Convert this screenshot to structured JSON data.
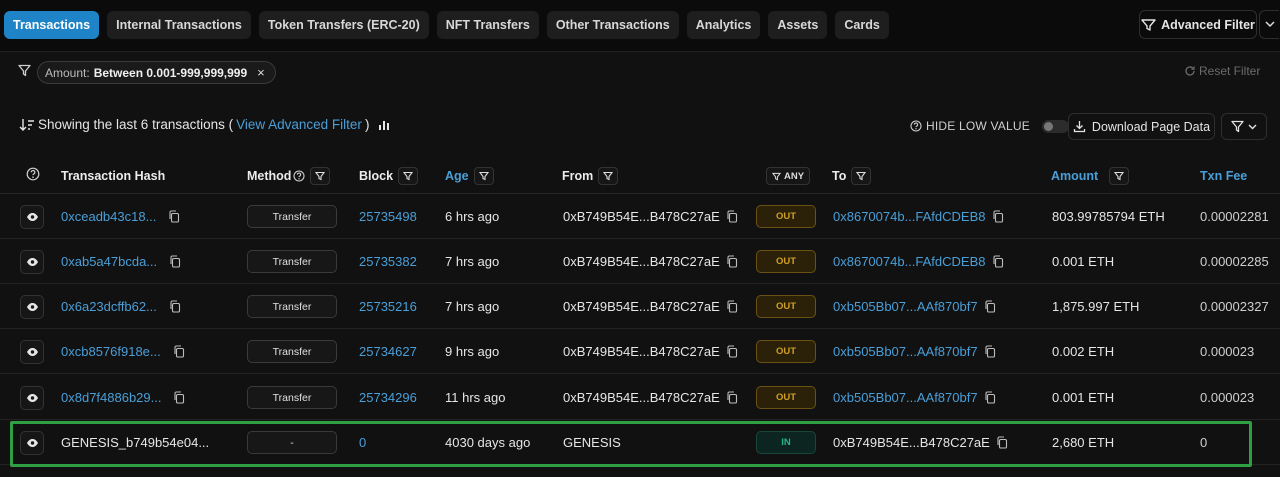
{
  "tabs": [
    {
      "label": "Transactions",
      "active": true
    },
    {
      "label": "Internal Transactions"
    },
    {
      "label": "Token Transfers (ERC-20)"
    },
    {
      "label": "NFT Transfers"
    },
    {
      "label": "Other Transactions"
    },
    {
      "label": "Analytics"
    },
    {
      "label": "Assets"
    },
    {
      "label": "Cards"
    }
  ],
  "advanced_filter_label": "Advanced Filter",
  "filter_chip": {
    "key": "Amount:",
    "value": "Between 0.001-999,999,999",
    "close": "×"
  },
  "reset_filter_label": "Reset Filter",
  "summary": {
    "prefix": "Showing the last 6 transactions (",
    "link": "View Advanced Filter",
    "suffix": ")"
  },
  "hide_low_value_label": "HIDE LOW VALUE",
  "download_label": "Download Page Data",
  "columns": {
    "hash": "Transaction Hash",
    "method": "Method",
    "block": "Block",
    "age": "Age",
    "from": "From",
    "direction": "ANY",
    "to": "To",
    "amount": "Amount",
    "fee": "Txn Fee"
  },
  "rows": [
    {
      "hash": "0xceadb43c18...",
      "method": "Transfer",
      "block": "25735498",
      "age": "6 hrs ago",
      "from": "0xB749B54E...B478C27aE",
      "direction": "OUT",
      "to": "0x8670074b...FAfdCDEB8",
      "amount": "803.99785794 ETH",
      "fee": "0.00002281"
    },
    {
      "hash": "0xab5a47bcda...",
      "method": "Transfer",
      "block": "25735382",
      "age": "7 hrs ago",
      "from": "0xB749B54E...B478C27aE",
      "direction": "OUT",
      "to": "0x8670074b...FAfdCDEB8",
      "amount": "0.001 ETH",
      "fee": "0.00002285"
    },
    {
      "hash": "0x6a23dcffb62...",
      "method": "Transfer",
      "block": "25735216",
      "age": "7 hrs ago",
      "from": "0xB749B54E...B478C27aE",
      "direction": "OUT",
      "to": "0xb505Bb07...AAf870bf7",
      "amount": "1,875.997 ETH",
      "fee": "0.00002327"
    },
    {
      "hash": "0xcb8576f918e...",
      "method": "Transfer",
      "block": "25734627",
      "age": "9 hrs ago",
      "from": "0xB749B54E...B478C27aE",
      "direction": "OUT",
      "to": "0xb505Bb07...AAf870bf7",
      "amount": "0.002 ETH",
      "fee": "0.000023"
    },
    {
      "hash": "0x8d7f4886b29...",
      "method": "Transfer",
      "block": "25734296",
      "age": "11 hrs ago",
      "from": "0xB749B54E...B478C27aE",
      "direction": "OUT",
      "to": "0xb505Bb07...AAf870bf7",
      "amount": "0.001 ETH",
      "fee": "0.000023"
    },
    {
      "hash": "GENESIS_b749b54e04...",
      "method": "-",
      "block": "0",
      "age": "4030 days ago",
      "from": "GENESIS",
      "direction": "IN",
      "to": "0xB749B54E...B478C27aE",
      "amount": "2,680 ETH",
      "fee": "0"
    }
  ],
  "colors": {
    "accent": "#1f84c7",
    "link": "#4a9fd8",
    "out": "#d29f25",
    "in": "#27b38a",
    "highlight": "#2ea043"
  }
}
